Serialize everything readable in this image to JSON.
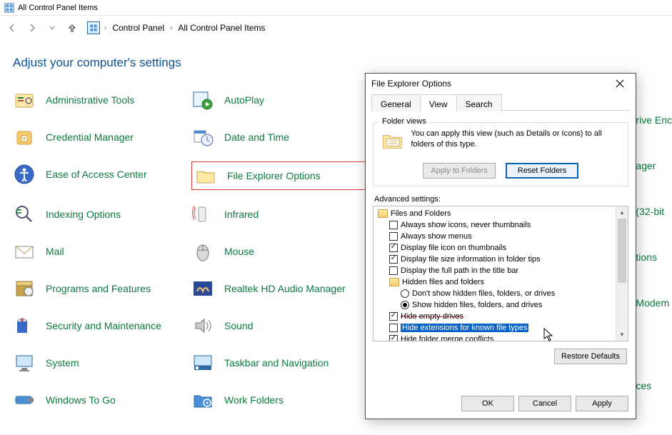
{
  "window_title": "All Control Panel Items",
  "breadcrumb": {
    "item0": "Control Panel",
    "item1": "All Control Panel Items"
  },
  "heading": "Adjust your computer's settings",
  "cp_items": {
    "col0": [
      "Administrative Tools",
      "Credential Manager",
      "Ease of Access Center",
      "Indexing Options",
      "Mail",
      "Programs and Features",
      "Security and Maintenance",
      "System",
      "Windows To Go"
    ],
    "col1": [
      "AutoPlay",
      "Date and Time",
      "File Explorer Options",
      "Infrared",
      "Mouse",
      "Realtek HD Audio Manager",
      "Sound",
      "Taskbar and Navigation",
      "Work Folders"
    ],
    "partial": [
      "rive Enc",
      "ager",
      "(32-bit",
      "tions",
      "Modem",
      "ces"
    ]
  },
  "dialog": {
    "title": "File Explorer Options",
    "tabs": {
      "t0": "General",
      "t1": "View",
      "t2": "Search"
    },
    "folder_views": {
      "legend": "Folder views",
      "text": "You can apply this view (such as Details or Icons) to all folders of this type.",
      "apply_btn": "Apply to Folders",
      "reset_btn": "Reset Folders"
    },
    "adv_label": "Advanced settings:",
    "tree": {
      "n0": "Files and Folders",
      "n1": "Always show icons, never thumbnails",
      "n2": "Always show menus",
      "n3": "Display file icon on thumbnails",
      "n4": "Display file size information in folder tips",
      "n5": "Display the full path in the title bar",
      "n6": "Hidden files and folders",
      "n7": "Don't show hidden files, folders, or drives",
      "n8": "Show hidden files, folders, and drives",
      "n9": "Hide empty drives",
      "n10": "Hide extensions for known file types",
      "n11": "Hide folder merge conflicts"
    },
    "restore_btn": "Restore Defaults",
    "footer": {
      "ok": "OK",
      "cancel": "Cancel",
      "apply": "Apply"
    }
  }
}
